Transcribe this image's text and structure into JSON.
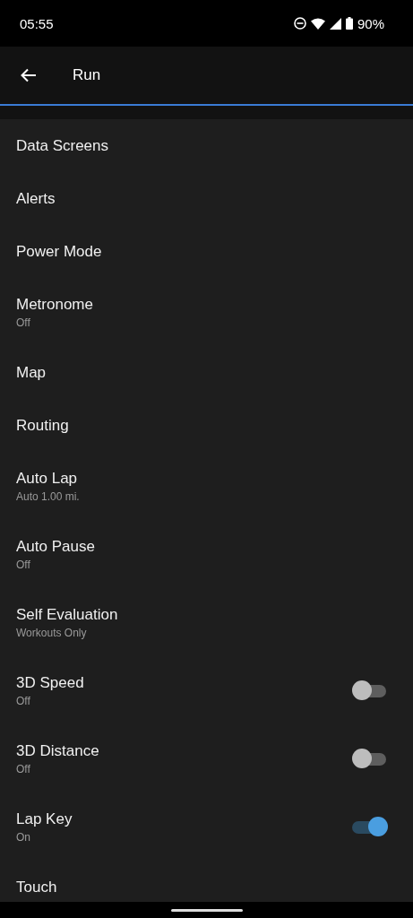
{
  "status_bar": {
    "time": "05:55",
    "battery": "90%"
  },
  "toolbar": {
    "title": "Run"
  },
  "items": [
    {
      "kind": "plain",
      "title": "Data Screens"
    },
    {
      "kind": "plain",
      "title": "Alerts"
    },
    {
      "kind": "plain",
      "title": "Power Mode"
    },
    {
      "kind": "plain",
      "title": "Metronome",
      "subtitle": "Off"
    },
    {
      "kind": "plain",
      "title": "Map"
    },
    {
      "kind": "plain",
      "title": "Routing"
    },
    {
      "kind": "plain",
      "title": "Auto Lap",
      "subtitle": "Auto 1.00 mi."
    },
    {
      "kind": "plain",
      "title": "Auto Pause",
      "subtitle": "Off"
    },
    {
      "kind": "plain",
      "title": "Self Evaluation",
      "subtitle": "Workouts Only"
    },
    {
      "kind": "toggle",
      "title": "3D Speed",
      "subtitle": "Off",
      "on": false
    },
    {
      "kind": "toggle",
      "title": "3D Distance",
      "subtitle": "Off",
      "on": false
    },
    {
      "kind": "toggle",
      "title": "Lap Key",
      "subtitle": "On",
      "on": true
    },
    {
      "kind": "plain",
      "title": "Touch"
    }
  ]
}
